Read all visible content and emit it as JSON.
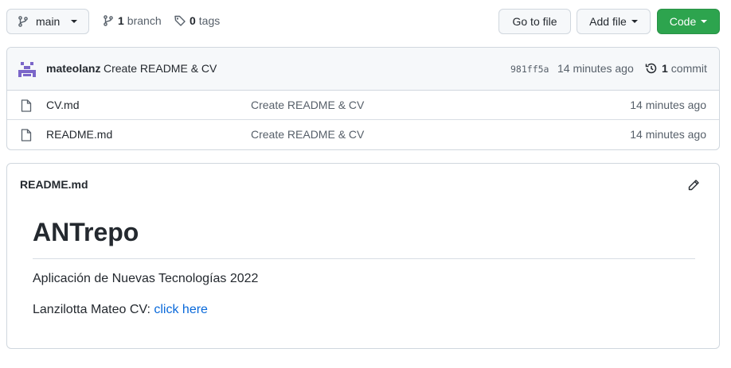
{
  "toolbar": {
    "branch_label": "main",
    "branch_count": "1",
    "branch_word": "branch",
    "tag_count": "0",
    "tag_word": "tags",
    "goto_label": "Go to file",
    "add_file_label": "Add file",
    "code_label": "Code"
  },
  "commit": {
    "author": "mateolanz",
    "message": "Create README & CV",
    "sha": "981ff5a",
    "time": "14 minutes ago",
    "count": "1",
    "count_word": "commit"
  },
  "files": [
    {
      "name": "CV.md",
      "commit_message": "Create README & CV",
      "time": "14 minutes ago"
    },
    {
      "name": "README.md",
      "commit_message": "Create README & CV",
      "time": "14 minutes ago"
    }
  ],
  "readme": {
    "filename": "README.md",
    "heading": "ANTrepo",
    "paragraph1": "Aplicación de Nuevas Tecnologías 2022",
    "paragraph2_prefix": "Lanzilotta Mateo CV: ",
    "link_text": "click here"
  },
  "colors": {
    "code_button": "#2da44e",
    "link": "#0969da",
    "avatar": "#7b66c9"
  }
}
